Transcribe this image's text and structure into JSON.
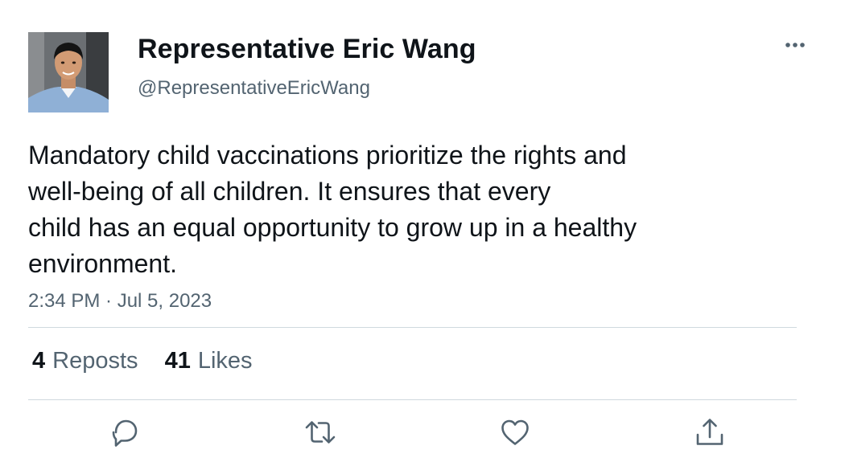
{
  "author": {
    "display_name": "Representative Eric Wang",
    "handle": "@RepresentativeEricWang",
    "avatar_icon": "profile-photo"
  },
  "tweet": {
    "text_lines": [
      "Mandatory child vaccinations prioritize the rights and",
      "well-being of all children. It ensures that every",
      "child has an equal opportunity to grow up in a healthy",
      "environment."
    ],
    "timestamp": "2:34 PM · Jul 5, 2023"
  },
  "stats": {
    "reposts": {
      "count": "4",
      "label": "Reposts"
    },
    "likes": {
      "count": "41",
      "label": "Likes"
    }
  },
  "actions": [
    {
      "name": "reply",
      "icon": "reply-icon"
    },
    {
      "name": "repost",
      "icon": "repost-icon"
    },
    {
      "name": "like",
      "icon": "heart-icon"
    },
    {
      "name": "share",
      "icon": "share-icon"
    }
  ],
  "menu_icon": "more-options-icon",
  "colors": {
    "text": "#0f1419",
    "secondary": "#536471",
    "divider": "#cfd9de"
  }
}
